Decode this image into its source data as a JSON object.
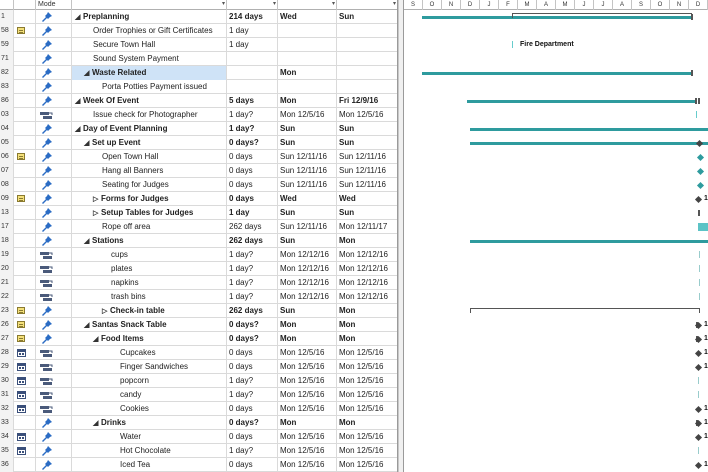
{
  "header": {
    "col_mode": "Mode"
  },
  "timeline": {
    "months": [
      "S",
      "O",
      "N",
      "D",
      "J",
      "F",
      "M",
      "A",
      "M",
      "J",
      "J",
      "A",
      "S",
      "O",
      "N",
      "D"
    ],
    "bar_color": "#2e9b9e"
  },
  "rows": [
    {
      "id": "1",
      "ind": "",
      "mode": "manual",
      "indent": 0,
      "tri": "open",
      "name": "Preplanning",
      "bold": true,
      "dur": "214 days",
      "start": "Wed",
      "fin": "Sun"
    },
    {
      "id": "58",
      "ind": "note",
      "mode": "manual",
      "indent": 2,
      "tri": "",
      "name": "Order Trophies or Gift Certificates",
      "bold": false,
      "dur": "1 day",
      "start": "",
      "fin": ""
    },
    {
      "id": "59",
      "ind": "",
      "mode": "manual",
      "indent": 2,
      "tri": "",
      "name": "Secure Town Hall",
      "bold": false,
      "dur": "1 day",
      "start": "",
      "fin": ""
    },
    {
      "id": "71",
      "ind": "",
      "mode": "manual",
      "indent": 2,
      "tri": "",
      "name": "Sound System Payment",
      "bold": false,
      "dur": "",
      "start": "",
      "fin": ""
    },
    {
      "id": "82",
      "ind": "",
      "mode": "manual",
      "indent": 1,
      "tri": "open",
      "name": "Waste Related",
      "bold": true,
      "dur": "",
      "start": "Mon",
      "fin": "",
      "selected": true
    },
    {
      "id": "83",
      "ind": "",
      "mode": "manual",
      "indent": 3,
      "tri": "",
      "name": "Porta Potties Payment issued",
      "bold": false,
      "dur": "",
      "start": "",
      "fin": ""
    },
    {
      "id": "86",
      "ind": "",
      "mode": "manual",
      "indent": 0,
      "tri": "open",
      "name": "Week Of Event",
      "bold": true,
      "dur": "5 days",
      "start": "Mon",
      "fin": "Fri 12/9/16"
    },
    {
      "id": "03",
      "ind": "",
      "mode": "auto",
      "indent": 2,
      "tri": "",
      "name": "Issue check for Photographer",
      "bold": false,
      "dur": "1 day?",
      "start": "Mon 12/5/16",
      "fin": "Mon 12/5/16"
    },
    {
      "id": "04",
      "ind": "",
      "mode": "manual",
      "indent": 0,
      "tri": "open",
      "name": "Day of Event Planning",
      "bold": true,
      "dur": "1 day?",
      "start": "Sun",
      "fin": "Sun"
    },
    {
      "id": "05",
      "ind": "",
      "mode": "manual",
      "indent": 1,
      "tri": "open",
      "name": "Set up Event",
      "bold": true,
      "dur": "0 days?",
      "start": "Sun",
      "fin": "Sun"
    },
    {
      "id": "06",
      "ind": "note",
      "mode": "manual",
      "indent": 3,
      "tri": "",
      "name": "Open Town Hall",
      "bold": false,
      "dur": "0 days",
      "start": "Sun 12/11/16",
      "fin": "Sun 12/11/16"
    },
    {
      "id": "07",
      "ind": "",
      "mode": "manual",
      "indent": 3,
      "tri": "",
      "name": "Hang all Banners",
      "bold": false,
      "dur": "0 days",
      "start": "Sun 12/11/16",
      "fin": "Sun 12/11/16"
    },
    {
      "id": "08",
      "ind": "",
      "mode": "manual",
      "indent": 3,
      "tri": "",
      "name": "Seating for Judges",
      "bold": false,
      "dur": "0 days",
      "start": "Sun 12/11/16",
      "fin": "Sun 12/11/16"
    },
    {
      "id": "09",
      "ind": "note",
      "mode": "manual",
      "indent": 2,
      "tri": "closed",
      "name": "Forms for Judges",
      "bold": true,
      "dur": "0 days",
      "start": "Wed",
      "fin": "Wed"
    },
    {
      "id": "13",
      "ind": "",
      "mode": "manual",
      "indent": 2,
      "tri": "closed",
      "name": "Setup Tables for Judges",
      "bold": true,
      "dur": "1 day",
      "start": "Sun",
      "fin": "Sun"
    },
    {
      "id": "17",
      "ind": "",
      "mode": "manual",
      "indent": 3,
      "tri": "",
      "name": "Rope off area",
      "bold": false,
      "dur": "262 days",
      "start": "Sun 12/11/16",
      "fin": "Mon 12/11/17"
    },
    {
      "id": "18",
      "ind": "",
      "mode": "manual",
      "indent": 1,
      "tri": "open",
      "name": "Stations",
      "bold": true,
      "dur": "262 days",
      "start": "Sun",
      "fin": "Mon"
    },
    {
      "id": "19",
      "ind": "",
      "mode": "auto",
      "indent": 4,
      "tri": "",
      "name": "cups",
      "bold": false,
      "dur": "1 day?",
      "start": "Mon 12/12/16",
      "fin": "Mon 12/12/16"
    },
    {
      "id": "20",
      "ind": "",
      "mode": "auto",
      "indent": 4,
      "tri": "",
      "name": "plates",
      "bold": false,
      "dur": "1 day?",
      "start": "Mon 12/12/16",
      "fin": "Mon 12/12/16"
    },
    {
      "id": "21",
      "ind": "",
      "mode": "auto",
      "indent": 4,
      "tri": "",
      "name": "napkins",
      "bold": false,
      "dur": "1 day?",
      "start": "Mon 12/12/16",
      "fin": "Mon 12/12/16"
    },
    {
      "id": "22",
      "ind": "",
      "mode": "auto",
      "indent": 4,
      "tri": "",
      "name": "trash bins",
      "bold": false,
      "dur": "1 day?",
      "start": "Mon 12/12/16",
      "fin": "Mon 12/12/16"
    },
    {
      "id": "23",
      "ind": "note",
      "mode": "manual",
      "indent": 3,
      "tri": "closed",
      "name": "Check-in table",
      "bold": true,
      "dur": "262 days",
      "start": "Sun",
      "fin": "Mon"
    },
    {
      "id": "26",
      "ind": "note",
      "mode": "manual",
      "indent": 1,
      "tri": "open",
      "name": "Santas Snack Table",
      "bold": true,
      "dur": "0 days?",
      "start": "Mon",
      "fin": "Mon"
    },
    {
      "id": "27",
      "ind": "note",
      "mode": "manual",
      "indent": 2,
      "tri": "open",
      "name": "Food Items",
      "bold": true,
      "dur": "0 days?",
      "start": "Mon",
      "fin": "Mon"
    },
    {
      "id": "28",
      "ind": "cal",
      "mode": "auto",
      "indent": 5,
      "tri": "",
      "name": "Cupcakes",
      "bold": false,
      "dur": "0 days",
      "start": "Mon 12/5/16",
      "fin": "Mon 12/5/16"
    },
    {
      "id": "29",
      "ind": "cal",
      "mode": "auto",
      "indent": 5,
      "tri": "",
      "name": "Finger Sandwiches",
      "bold": false,
      "dur": "0 days",
      "start": "Mon 12/5/16",
      "fin": "Mon 12/5/16"
    },
    {
      "id": "30",
      "ind": "cal",
      "mode": "auto",
      "indent": 5,
      "tri": "",
      "name": "popcorn",
      "bold": false,
      "dur": "1 day?",
      "start": "Mon 12/5/16",
      "fin": "Mon 12/5/16"
    },
    {
      "id": "31",
      "ind": "cal",
      "mode": "auto",
      "indent": 5,
      "tri": "",
      "name": "candy",
      "bold": false,
      "dur": "1 day?",
      "start": "Mon 12/5/16",
      "fin": "Mon 12/5/16"
    },
    {
      "id": "32",
      "ind": "cal",
      "mode": "auto",
      "indent": 5,
      "tri": "",
      "name": "Cookies",
      "bold": false,
      "dur": "0 days",
      "start": "Mon 12/5/16",
      "fin": "Mon 12/5/16"
    },
    {
      "id": "33",
      "ind": "",
      "mode": "manual",
      "indent": 2,
      "tri": "open",
      "name": "Drinks",
      "bold": true,
      "dur": "0 days?",
      "start": "Mon",
      "fin": "Mon"
    },
    {
      "id": "34",
      "ind": "cal",
      "mode": "manual",
      "indent": 5,
      "tri": "",
      "name": "Water",
      "bold": false,
      "dur": "0 days",
      "start": "Mon 12/5/16",
      "fin": "Mon 12/5/16"
    },
    {
      "id": "35",
      "ind": "cal",
      "mode": "manual",
      "indent": 5,
      "tri": "",
      "name": "Hot Chocolate",
      "bold": false,
      "dur": "1 day?",
      "start": "Mon 12/5/16",
      "fin": "Mon 12/5/16"
    },
    {
      "id": "36",
      "ind": "",
      "mode": "manual",
      "indent": 5,
      "tri": "",
      "name": "Iced Tea",
      "bold": false,
      "dur": "0 days",
      "start": "Mon 12/5/16",
      "fin": "Mon 12/5/16"
    }
  ],
  "gantt": {
    "label_fire": "Fire Department",
    "label_one": "1"
  }
}
